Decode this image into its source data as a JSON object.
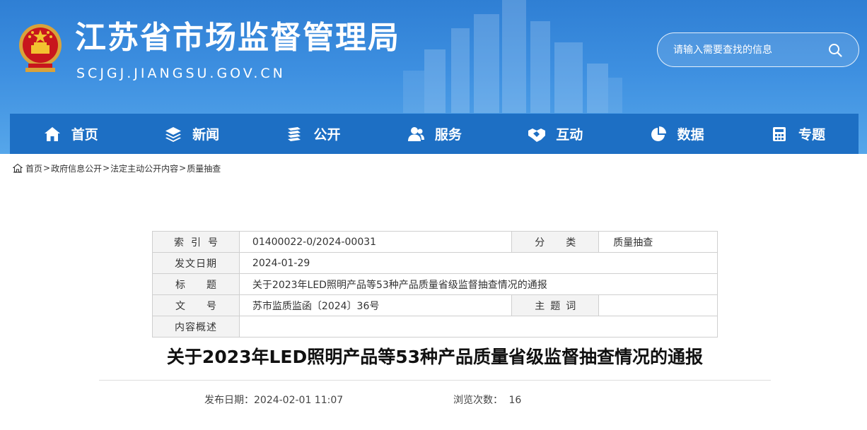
{
  "header": {
    "site_title": "江苏省市场监督管理局",
    "site_domain": "SCJGJ.JIANGSU.GOV.CN",
    "search_placeholder": "请输入需要查找的信息"
  },
  "nav": {
    "items": [
      {
        "label": "首页",
        "icon": "home-icon"
      },
      {
        "label": "新闻",
        "icon": "layers-icon"
      },
      {
        "label": "公开",
        "icon": "book-stack-icon"
      },
      {
        "label": "服务",
        "icon": "users-icon"
      },
      {
        "label": "互动",
        "icon": "handshake-icon"
      },
      {
        "label": "数据",
        "icon": "pie-chart-icon"
      },
      {
        "label": "专题",
        "icon": "calculator-icon"
      }
    ]
  },
  "breadcrumb": {
    "items": [
      "首页",
      "政府信息公开",
      "法定主动公开内容",
      "质量抽查"
    ],
    "separator": ">"
  },
  "info": {
    "index_label": "索引号",
    "index_value": "01400022-0/2024-00031",
    "category_label": "分类",
    "category_value": "质量抽查",
    "date_label": "发文日期",
    "date_value": "2024-01-29",
    "title_label": "标题",
    "title_value": "关于2023年LED照明产品等53种产品质量省级监督抽查情况的通报",
    "docno_label": "文号",
    "docno_value": "苏市监质监函〔2024〕36号",
    "keyword_label": "主题词",
    "keyword_value": "",
    "summary_label": "内容概述",
    "summary_value": ""
  },
  "article": {
    "title": "关于2023年LED照明产品等53种产品质量省级监督抽查情况的通报",
    "publish_label": "发布日期：",
    "publish_value": "2024-02-01 11:07",
    "views_label": "浏览次数：",
    "views_value": "16"
  },
  "colors": {
    "banner": "#3d8fe0",
    "nav": "#1d6fc4",
    "label_bg": "#f3f3f3"
  }
}
